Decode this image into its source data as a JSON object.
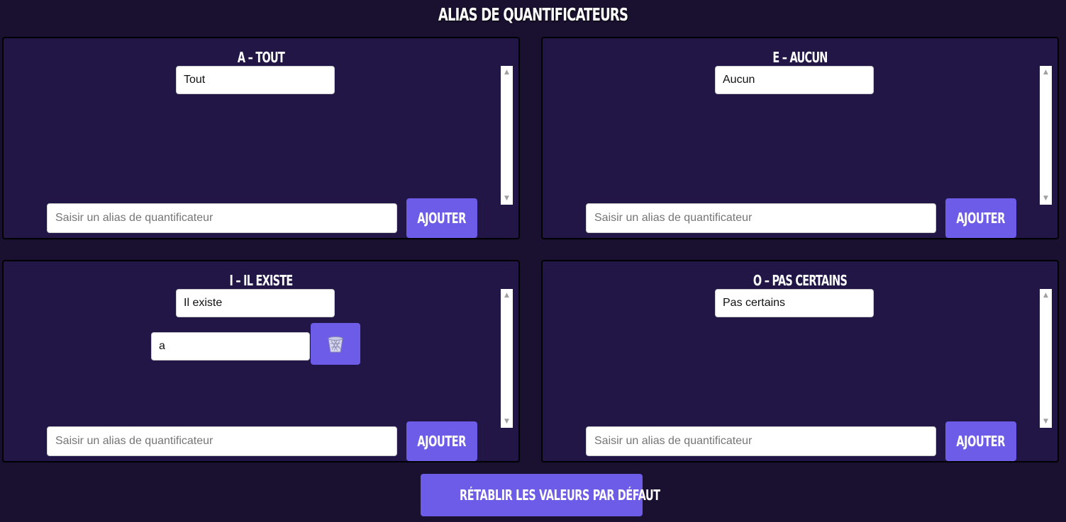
{
  "page": {
    "title": "ALIAS DE QUANTIFICATEURS"
  },
  "panels": [
    {
      "title": "A – TOUT",
      "aliases": [
        "Tout"
      ],
      "add_placeholder": "Saisir un alias de quantificateur",
      "add_label": "AJOUTER"
    },
    {
      "title": "E – AUCUN",
      "aliases": [
        "Aucun"
      ],
      "add_placeholder": "Saisir un alias de quantificateur",
      "add_label": "AJOUTER"
    },
    {
      "title": "I – IL EXISTE",
      "aliases": [
        "Il existe",
        "a"
      ],
      "add_placeholder": "Saisir un alias de quantificateur",
      "add_label": "AJOUTER"
    },
    {
      "title": "O – PAS CERTAINS",
      "aliases": [
        "Pas certains"
      ],
      "add_placeholder": "Saisir un alias de quantificateur",
      "add_label": "AJOUTER"
    }
  ],
  "reset_label": "RÉTABLIR LES VALEURS PAR DÉFAUT",
  "icons": {
    "scroll_up": "▲",
    "scroll_down": "▼",
    "delete": "trash-icon"
  },
  "colors": {
    "accent": "#6c5ce7",
    "panel_bg": "#221646",
    "page_bg": "#1a1030"
  }
}
